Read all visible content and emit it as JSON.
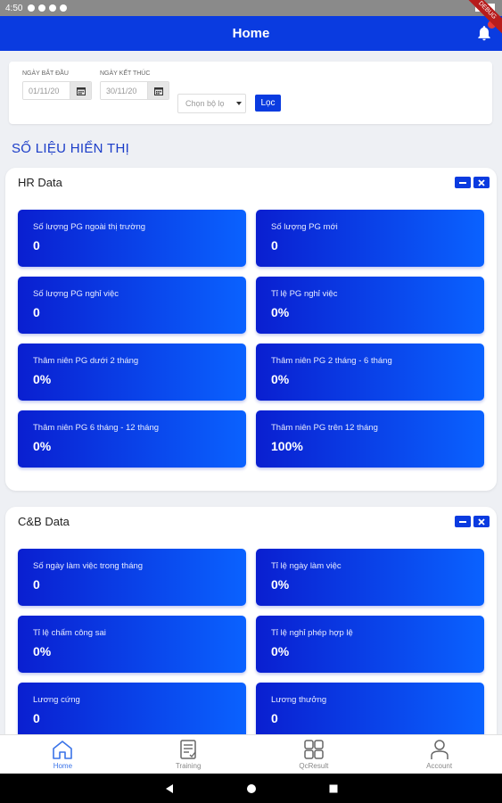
{
  "status_bar": {
    "time": "4:50"
  },
  "debug_banner": "DEBUG",
  "app_bar": {
    "title": "Home"
  },
  "filters": {
    "start_label": "NGÀY BẮT ĐẦU",
    "start_value": "01/11/20",
    "end_label": "NGÀY KẾT THÚC",
    "end_value": "30/11/20",
    "select_placeholder": "Chọn bộ lọ",
    "apply_label": "Lọc"
  },
  "section_title": "SỐ LIỆU HIỂN THỊ",
  "hr_card": {
    "title": "HR Data",
    "tiles": [
      {
        "label": "Số lượng PG ngoài thị trường",
        "value": "0"
      },
      {
        "label": "Số lượng PG mới",
        "value": "0"
      },
      {
        "label": "Số lượng PG nghỉ việc",
        "value": "0"
      },
      {
        "label": "Tỉ lệ PG nghỉ việc",
        "value": "0%"
      },
      {
        "label": "Thâm niên PG dưới 2 tháng",
        "value": "0%"
      },
      {
        "label": "Thâm niên PG 2 tháng - 6 tháng",
        "value": "0%"
      },
      {
        "label": "Thâm niên PG 6 tháng - 12 tháng",
        "value": "0%"
      },
      {
        "label": "Thâm niên PG trên 12 tháng",
        "value": "100%"
      }
    ]
  },
  "cb_card": {
    "title": "C&B Data",
    "tiles": [
      {
        "label": "Số ngày làm việc trong tháng",
        "value": "0"
      },
      {
        "label": "Tỉ lệ ngày làm việc",
        "value": "0%"
      },
      {
        "label": "Tỉ lệ chấm công sai",
        "value": "0%"
      },
      {
        "label": "Tỉ lệ nghỉ phép hợp lệ",
        "value": "0%"
      },
      {
        "label": "Lương cứng",
        "value": "0"
      },
      {
        "label": "Lương thưởng",
        "value": "0"
      }
    ]
  },
  "bottom_nav": [
    {
      "label": "Home",
      "icon": "home-icon"
    },
    {
      "label": "Training",
      "icon": "clipboard-icon"
    },
    {
      "label": "QcResult",
      "icon": "grid-icon"
    },
    {
      "label": "Account",
      "icon": "person-icon"
    }
  ],
  "colors": {
    "primary": "#0a3be0",
    "tile_start": "#0a1fd0",
    "tile_end": "#0a62ff",
    "active_nav": "#3a73e8"
  }
}
